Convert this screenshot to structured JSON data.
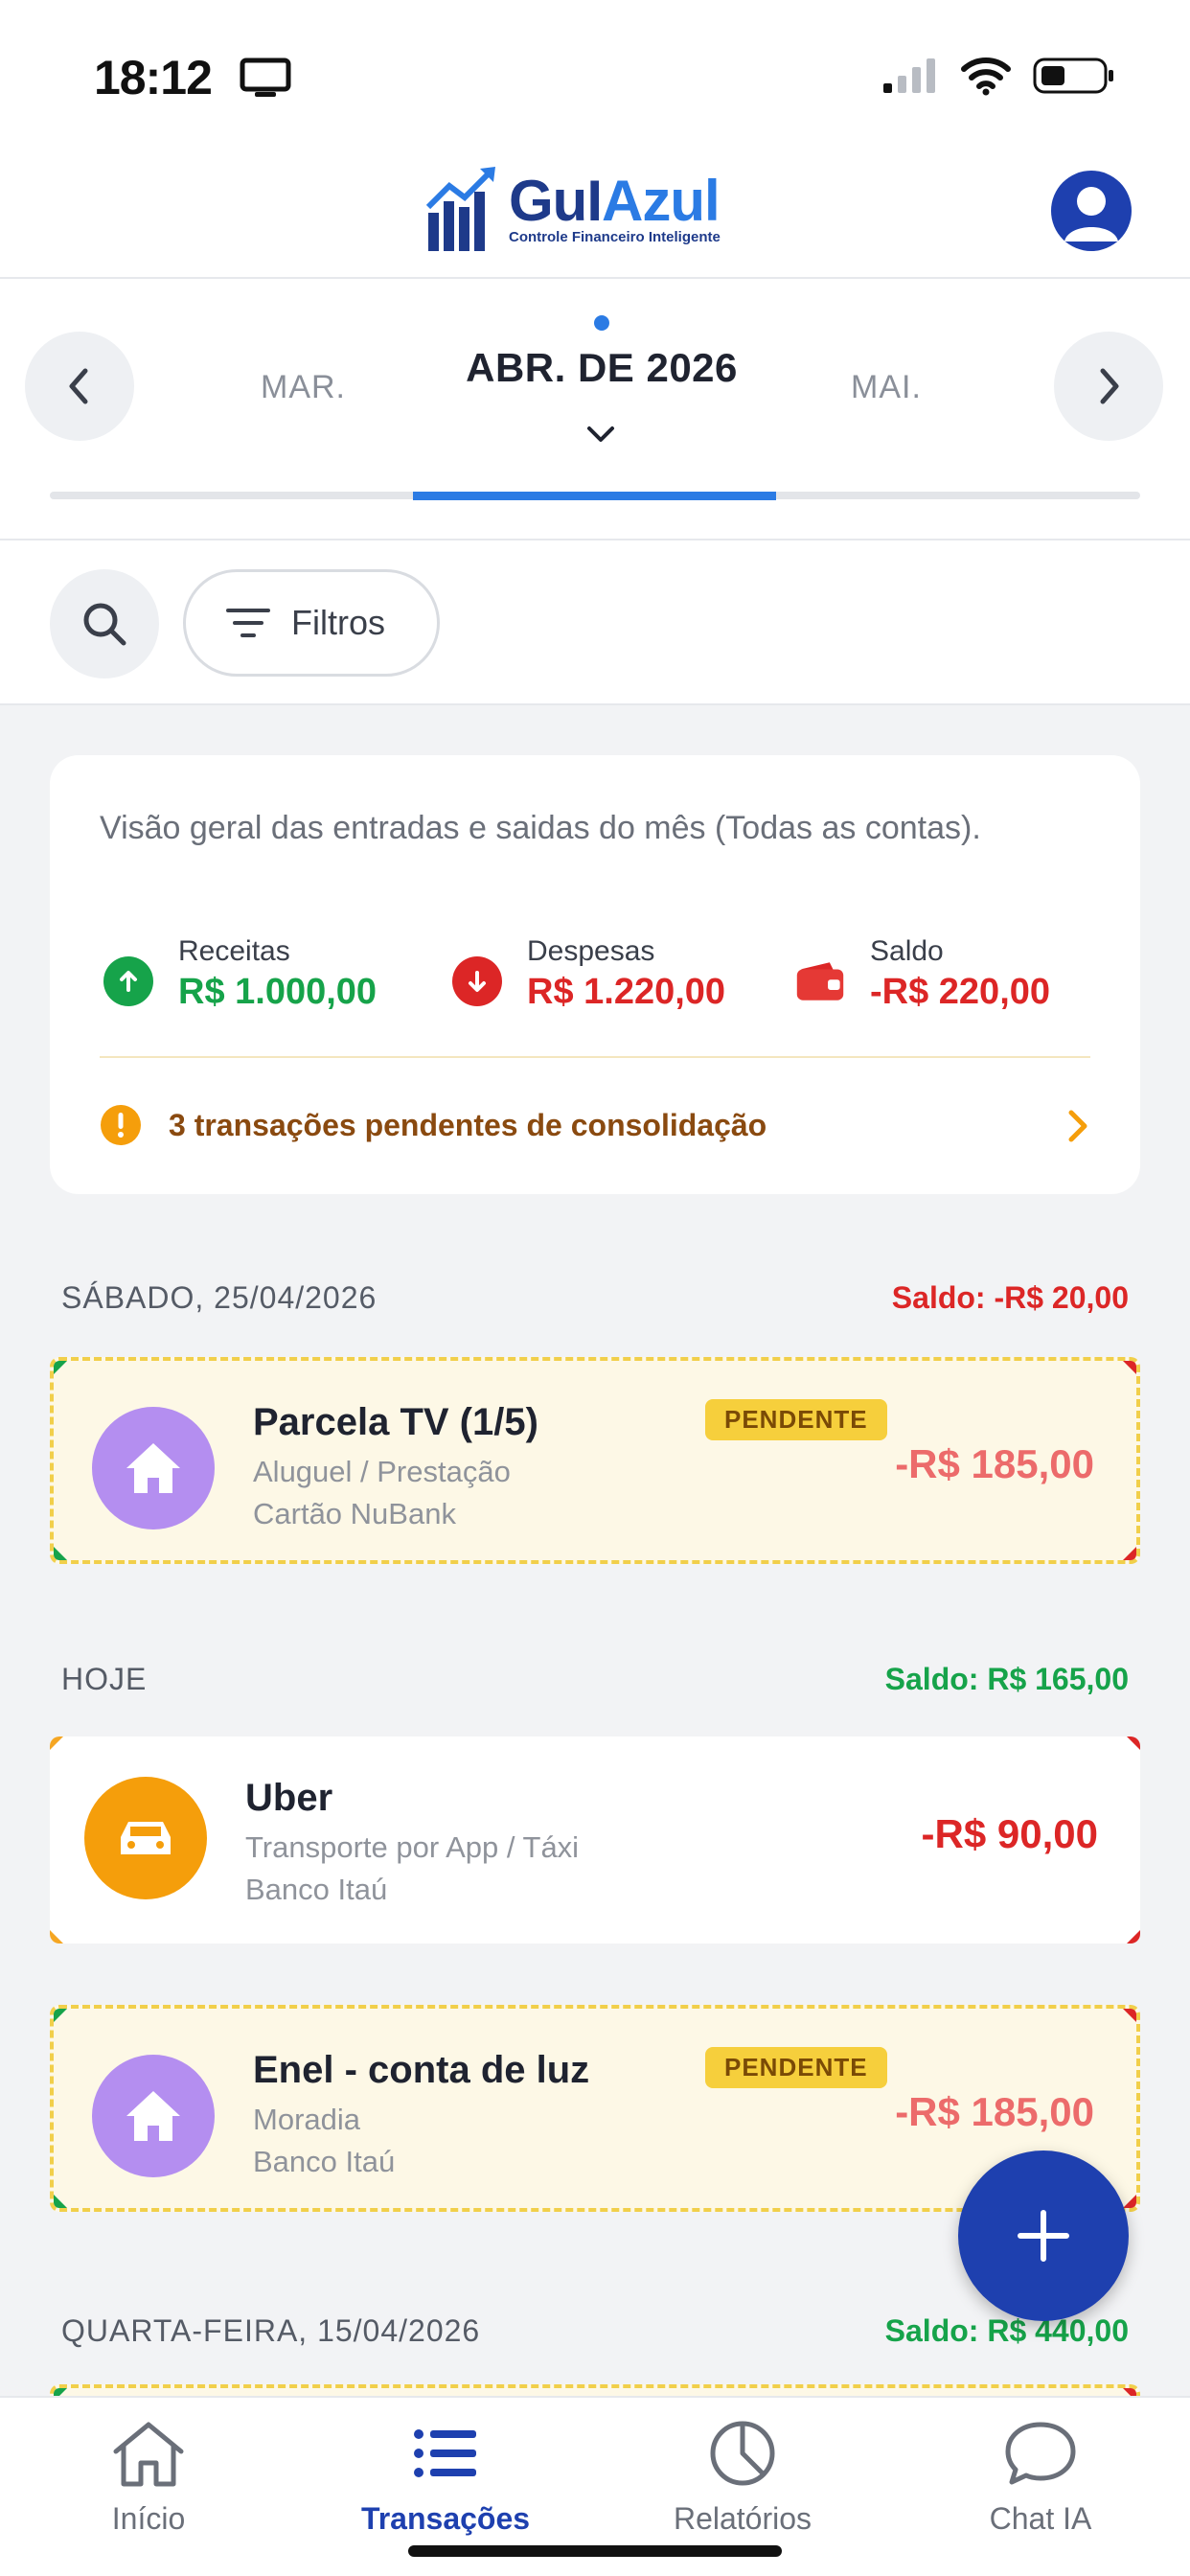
{
  "status_bar": {
    "time": "18:12"
  },
  "header": {
    "logo_prefix": "GuI",
    "logo_accent": "Azul",
    "logo_tagline": "Controle Financeiro Inteligente"
  },
  "month_selector": {
    "prev": "MAR.",
    "current": "ABR. DE 2026",
    "next": "MAI."
  },
  "filters": {
    "filter_label": "Filtros"
  },
  "overview": {
    "description": "Visão geral das entradas e saidas do mês (Todas as contas).",
    "income_label": "Receitas",
    "income_value": "R$ 1.000,00",
    "expense_label": "Despesas",
    "expense_value": "R$ 1.220,00",
    "balance_label": "Saldo",
    "balance_value": "-R$ 220,00",
    "pending_text": "3 transações pendentes de consolidação"
  },
  "days": [
    {
      "label": "SÁBADO, 25/04/2026",
      "saldo": "Saldo: -R$ 20,00",
      "saldo_color": "#dc2626"
    },
    {
      "label": "HOJE",
      "saldo": "Saldo: R$ 165,00",
      "saldo_color": "#16a34a"
    },
    {
      "label": "QUARTA-FEIRA, 15/04/2026",
      "saldo": "Saldo: R$ 440,00",
      "saldo_color": "#16a34a"
    }
  ],
  "transactions": [
    {
      "title": "Parcela TV (1/5)",
      "category": "Aluguel / Prestação",
      "account": "Cartão NuBank",
      "badge": "PENDENTE",
      "amount": "-R$ 185,00",
      "icon": "home-icon"
    },
    {
      "title": "Uber",
      "category": "Transporte por App / Táxi",
      "account": "Banco Itaú",
      "amount": "-R$ 90,00",
      "icon": "car-icon"
    },
    {
      "title": "Enel - conta de luz",
      "category": "Moradia",
      "account": "Banco Itaú",
      "badge": "PENDENTE",
      "amount": "-R$ 185,00",
      "icon": "home-icon"
    }
  ],
  "bottom_nav": [
    {
      "label": "Início",
      "icon": "home-outline-icon"
    },
    {
      "label": "Transações",
      "icon": "list-icon",
      "active": true
    },
    {
      "label": "Relatórios",
      "icon": "pie-chart-icon"
    },
    {
      "label": "Chat IA",
      "icon": "chat-icon"
    }
  ],
  "colors": {
    "primary": "#1e40af",
    "accent": "#2b7be4",
    "income": "#16a34a",
    "expense": "#dc2626",
    "pending_badge": "#f6cf3c"
  }
}
